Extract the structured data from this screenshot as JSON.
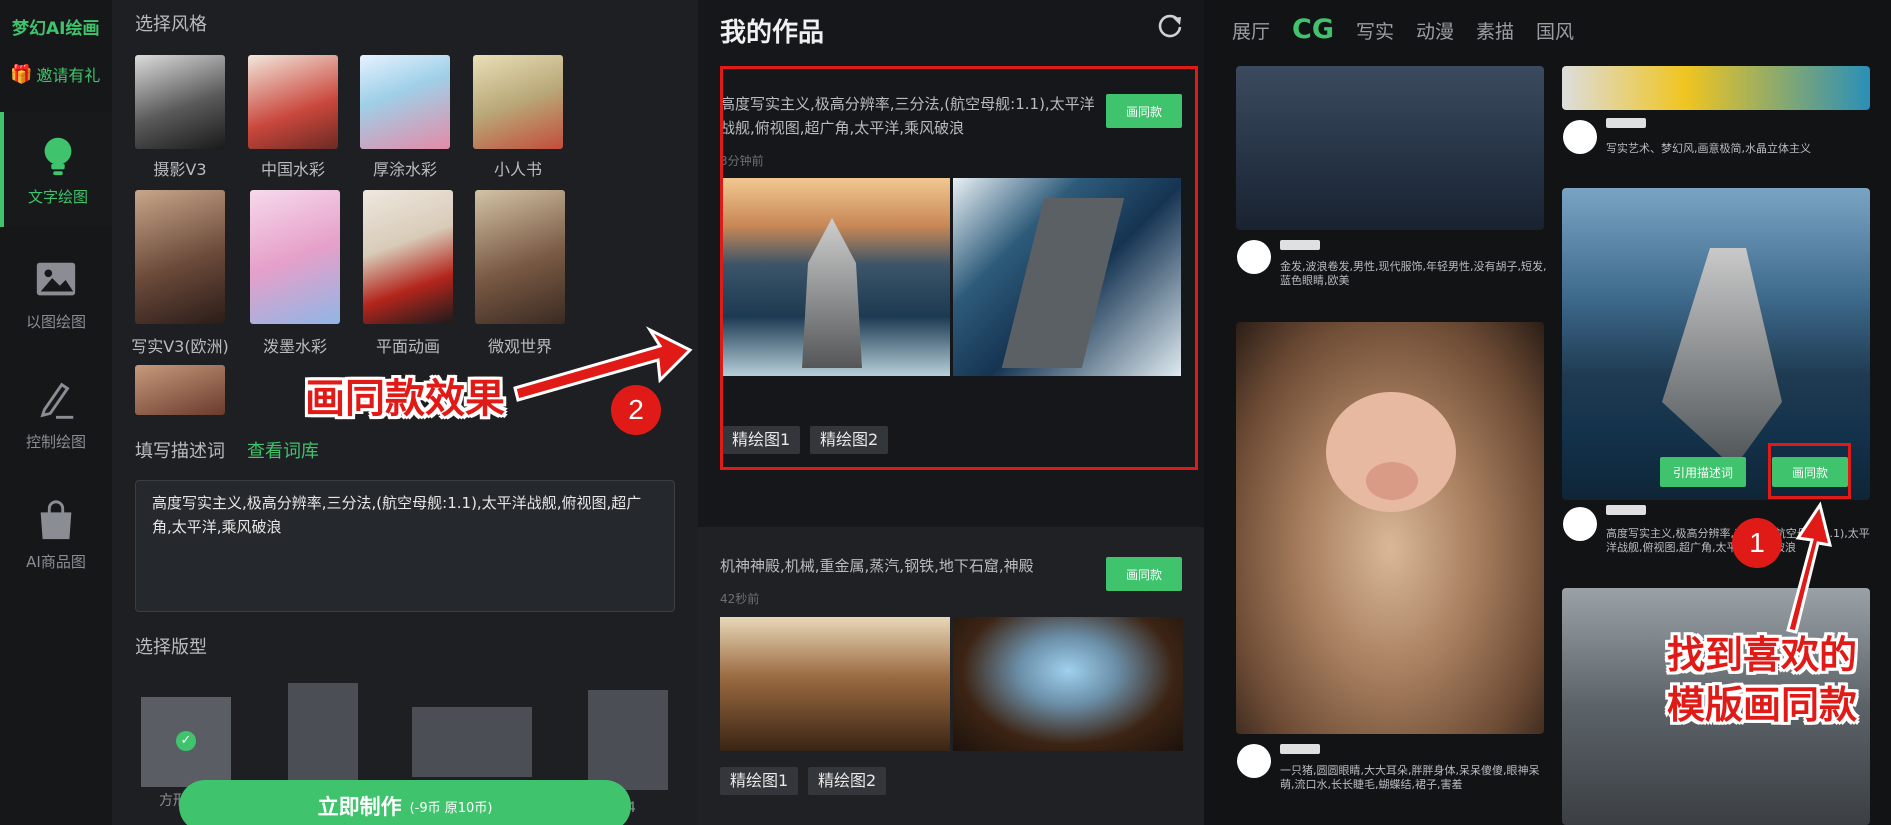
{
  "nav": {
    "brand": "梦幻AI绘画",
    "invite": "邀请有礼",
    "items": [
      {
        "label": "文字绘图",
        "icon": "bulb-icon",
        "active": true
      },
      {
        "label": "以图绘图",
        "icon": "image-icon",
        "active": false
      },
      {
        "label": "控制绘图",
        "icon": "pen-icon",
        "active": false
      },
      {
        "label": "AI商品图",
        "icon": "bag-icon",
        "active": false
      }
    ]
  },
  "style": {
    "section_title": "选择风格",
    "styles": [
      {
        "label": "摄影V3"
      },
      {
        "label": "中国水彩"
      },
      {
        "label": "厚涂水彩"
      },
      {
        "label": "小人书"
      },
      {
        "label": "写实V3(欧洲)"
      },
      {
        "label": "泼墨水彩"
      },
      {
        "label": "平面动画"
      },
      {
        "label": "微观世界"
      }
    ],
    "prompt_title": "填写描述词",
    "prompt_link": "查看词库",
    "prompt_value": "高度写实主义,极高分辨率,三分法,(航空母舰:1.1),太平洋战舰,俯视图,超广角,太平洋,乘风破浪",
    "layout_title": "选择版型",
    "layout_label_visible": "方形",
    "layout_num_visible": "4",
    "make_button": "立即制作",
    "make_cost": "(-9币 原10币)"
  },
  "works": {
    "title": "我的作品",
    "cards": [
      {
        "desc": "高度写实主义,极高分辨率,三分法,(航空母舰:1.1),太平洋战舰,俯视图,超广角,太平洋,乘风破浪",
        "time": "3分钟前",
        "same_btn": "画同款",
        "tags": [
          "精绘图1",
          "精绘图2"
        ]
      },
      {
        "desc": "机神神殿,机械,重金属,蒸汽,钢铁,地下石窟,神殿",
        "time": "42秒前",
        "same_btn": "画同款",
        "tags": [
          "精绘图1",
          "精绘图2"
        ]
      }
    ]
  },
  "gallery": {
    "tabs": [
      "展厅",
      "CG",
      "写实",
      "动漫",
      "素描",
      "国风"
    ],
    "active_tab": "CG",
    "items": [
      {
        "text": "金发,波浪卷发,男性,现代服饰,年轻男性,没有胡子,短发,蓝色眼睛,欧美"
      },
      {
        "text": "写实艺术、梦幻风,画意极简,水晶立体主义"
      },
      {
        "text": "一只猪,圆圆眼睛,大大耳朵,胖胖身体,呆呆傻傻,眼神呆萌,流口水,长长睫毛,蝴蝶结,裙子,害羞"
      },
      {
        "text": "高度写实主义,极高分辨率,三分法,(航空母舰:1.1),太平洋战舰,俯视图,超广角,太平洋,乘风破浪"
      }
    ],
    "quote_btn": "引用描述词",
    "same_btn": "画同款"
  },
  "annotations": {
    "badge1": "1",
    "badge2": "2",
    "callout1": "画同款效果",
    "callout2_line1": "找到喜欢的",
    "callout2_line2": "模版画同款",
    "color": "#e01b17"
  }
}
